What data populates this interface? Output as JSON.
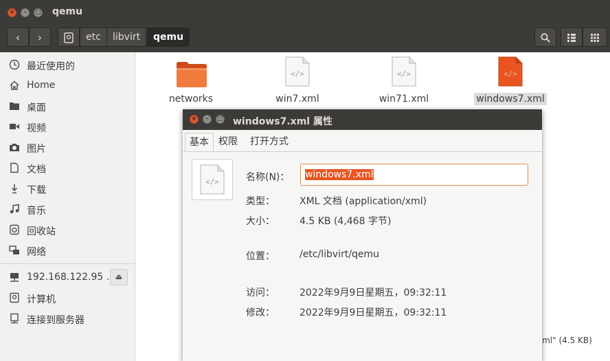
{
  "window": {
    "title": "qemu"
  },
  "toolbar": {
    "back_icon": "‹",
    "forward_icon": "›",
    "breadcrumbs": [
      {
        "label": "etc"
      },
      {
        "label": "libvirt"
      },
      {
        "label": "qemu"
      }
    ]
  },
  "sidebar": {
    "items": [
      {
        "label": "最近使用的",
        "icon": "clock-icon"
      },
      {
        "label": "Home",
        "icon": "home-icon"
      },
      {
        "label": "桌面",
        "icon": "folder-icon"
      },
      {
        "label": "视频",
        "icon": "video-icon"
      },
      {
        "label": "图片",
        "icon": "camera-icon"
      },
      {
        "label": "文档",
        "icon": "document-icon"
      },
      {
        "label": "下载",
        "icon": "download-icon"
      },
      {
        "label": "音乐",
        "icon": "music-icon"
      },
      {
        "label": "回收站",
        "icon": "trash-icon"
      },
      {
        "label": "网络",
        "icon": "network-icon"
      }
    ],
    "devices": [
      {
        "label": "192.168.122.95 ...",
        "icon": "network-drive-icon"
      },
      {
        "label": "计算机",
        "icon": "computer-icon"
      },
      {
        "label": "连接到服务器",
        "icon": "server-icon"
      }
    ]
  },
  "files": [
    {
      "name": "networks",
      "type": "folder"
    },
    {
      "name": "win7.xml",
      "type": "xml"
    },
    {
      "name": "win71.xml",
      "type": "xml"
    },
    {
      "name": "windows7.xml",
      "type": "xml",
      "selected": true
    }
  ],
  "status": {
    "text": "xml\" (4.5 KB)"
  },
  "dialog": {
    "title": "windows7.xml 属性",
    "tabs": [
      "基本",
      "权限",
      "打开方式"
    ],
    "fields": {
      "name_label": "名称(N)：",
      "name_value": "windows7.xml",
      "type_label": "类型：",
      "type_value": "XML 文档 (application/xml)",
      "size_label": "大小：",
      "size_value": "4.5 KB (4,468 字节)",
      "location_label": "位置：",
      "location_value": "/etc/libvirt/qemu",
      "accessed_label": "访问：",
      "accessed_value": "2022年9月9日星期五，09:32:11",
      "modified_label": "修改：",
      "modified_value": "2022年9月9日星期五，09:32:11"
    }
  },
  "colors": {
    "accent": "#e95420",
    "titlebar": "#3c3b37",
    "sidebar_bg": "#f2f1f0"
  }
}
